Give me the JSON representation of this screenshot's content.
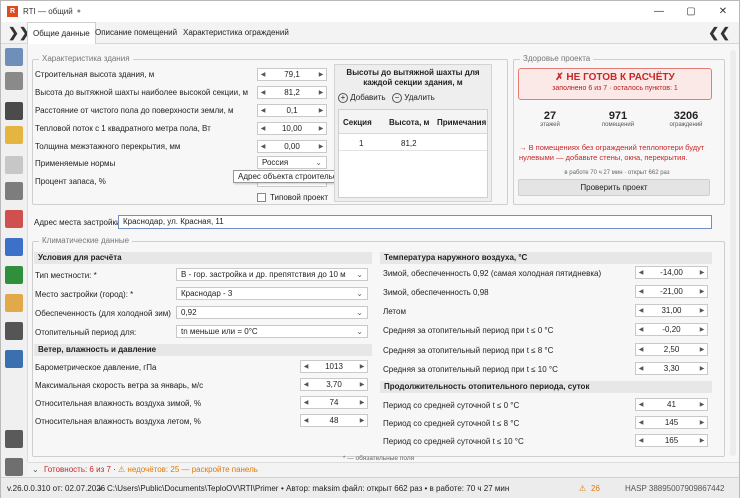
{
  "window": {
    "title": "RTI — общий",
    "minimize": "—",
    "maximize": "▢",
    "close": "✕"
  },
  "ribbon": {
    "tabs": [
      "Общие данные",
      "Описание помещений",
      "Характеристика ограждений"
    ],
    "left_chevron": "❯❯",
    "right_chevron": "❮❮"
  },
  "building": {
    "legend": "Характеристика здания",
    "rows": [
      {
        "label": "Строительная высота здания, м",
        "value": "79,1"
      },
      {
        "label": "Высота до вытяжной шахты наиболее высокой секции, м",
        "value": "81,2"
      },
      {
        "label": "Расстояние от чистого пола  до поверхности земли, м",
        "value": "0,1"
      },
      {
        "label": "Тепловой поток с 1 квадратного метра пола, Вт",
        "value": "10,00"
      },
      {
        "label": "Толщина межэтажного перекрытия, мм",
        "value": "0,00"
      }
    ],
    "norms_label": "Применяемые нормы",
    "norms_value": "Россия",
    "reserve_label": "Процент запаса, %",
    "tooltip": "Адрес объекта строительства",
    "typical_label": "Типовой проект",
    "address_label": "Адрес места застройки:",
    "address_value": "Краснодар, ул. Красная, 11"
  },
  "shaft": {
    "title": "Высоты до вытяжной шахты для каждой секции здания, м",
    "add": "Добавить",
    "remove": "Удалить",
    "cols": [
      "Секция",
      "Высота, м",
      "Примечания"
    ],
    "row": [
      "1",
      "81,2",
      ""
    ]
  },
  "health": {
    "legend": "Здоровье проекта",
    "status": "✗  НЕ ГОТОВ К РАСЧЁТУ",
    "sub": "заполнено 6 из 7 · осталось пунктов: 1",
    "stats": [
      {
        "num": "27",
        "lbl": "этажей"
      },
      {
        "num": "971",
        "lbl": "помещений"
      },
      {
        "num": "3206",
        "lbl": "ограждений"
      }
    ],
    "warning": "→  В помещениях без ограждений теплопотери будут нулевыми — добавьте стены, окна, перекрытия.",
    "time": "в работе 70 ч 27 мин · открыт 662 раз",
    "check_btn": "Проверить проект"
  },
  "climate": {
    "legend": "Климатические данные",
    "cond_title": "Условия для расчёта",
    "cond": [
      {
        "label": "Тип местности: *",
        "value": "B - гор. застройка и др. препятствия  до 10 м"
      },
      {
        "label": "Место застройки (город): *",
        "value": "Краснодар - 3"
      },
      {
        "label": "Обеспеченность (для холодной зим)",
        "value": "0,92"
      },
      {
        "label": "Отопительный период для:",
        "value": "tn меньше или = 0°С"
      }
    ],
    "wind_title": "Ветер, влажность и давление",
    "wind": [
      {
        "label": "Барометрическое давление, гПа",
        "value": "1013"
      },
      {
        "label": "Максимальная скорость ветра за январь, м/с",
        "value": "3,70"
      },
      {
        "label": "Относительная влажность воздуха зимой, %",
        "value": "74"
      },
      {
        "label": "Относительная влажность воздуха летом, %",
        "value": "48"
      }
    ],
    "temp_title": "Температура наружного воздуха, °С",
    "temp": [
      {
        "label": "Зимой, обеспеченность 0,92 (самая холодная пятидневка)",
        "value": "-14,00"
      },
      {
        "label": "Зимой, обеспеченность 0,98",
        "value": "-21,00"
      },
      {
        "label": "Летом",
        "value": "31,00"
      },
      {
        "label": "Средняя за отопительный период при t ≤ 0 °C",
        "value": "-0,20"
      },
      {
        "label": "Средняя за отопительный период при t ≤ 8 °C",
        "value": "2,50"
      },
      {
        "label": "Средняя за отопительный период при t ≤ 10 °C",
        "value": "3,30"
      }
    ],
    "dur_title": "Продолжительность отопительного периода, суток",
    "dur": [
      {
        "label": "Период со средней суточной t ≤ 0 °C",
        "value": "41"
      },
      {
        "label": "Период со средней суточной t ≤ 8 °C",
        "value": "145"
      },
      {
        "label": "Период со средней суточной t ≤ 10 °C",
        "value": "165"
      }
    ],
    "required_note": "* — обязательные поля"
  },
  "status": {
    "ready": "Готовность: 6 из 7",
    "sep": " · ",
    "warn": "⚠ недочётов: 25 — раскройте панель"
  },
  "footer": {
    "version": "v.26.0.0.310 от: 02.07.2026",
    "path": "C:\\Users\\Public\\Documents\\TeploOV\\RTI\\Primer",
    "author": "• Автор: maksim файл: открыт 662 раз  • в работе: 70 ч 27 мин",
    "warn_count": "26",
    "hasp": "HASP 38895007909867442"
  },
  "colors": {
    "accent": "#d83a2e",
    "warn": "#e07a00",
    "panel_red": "#fbe9e7"
  }
}
